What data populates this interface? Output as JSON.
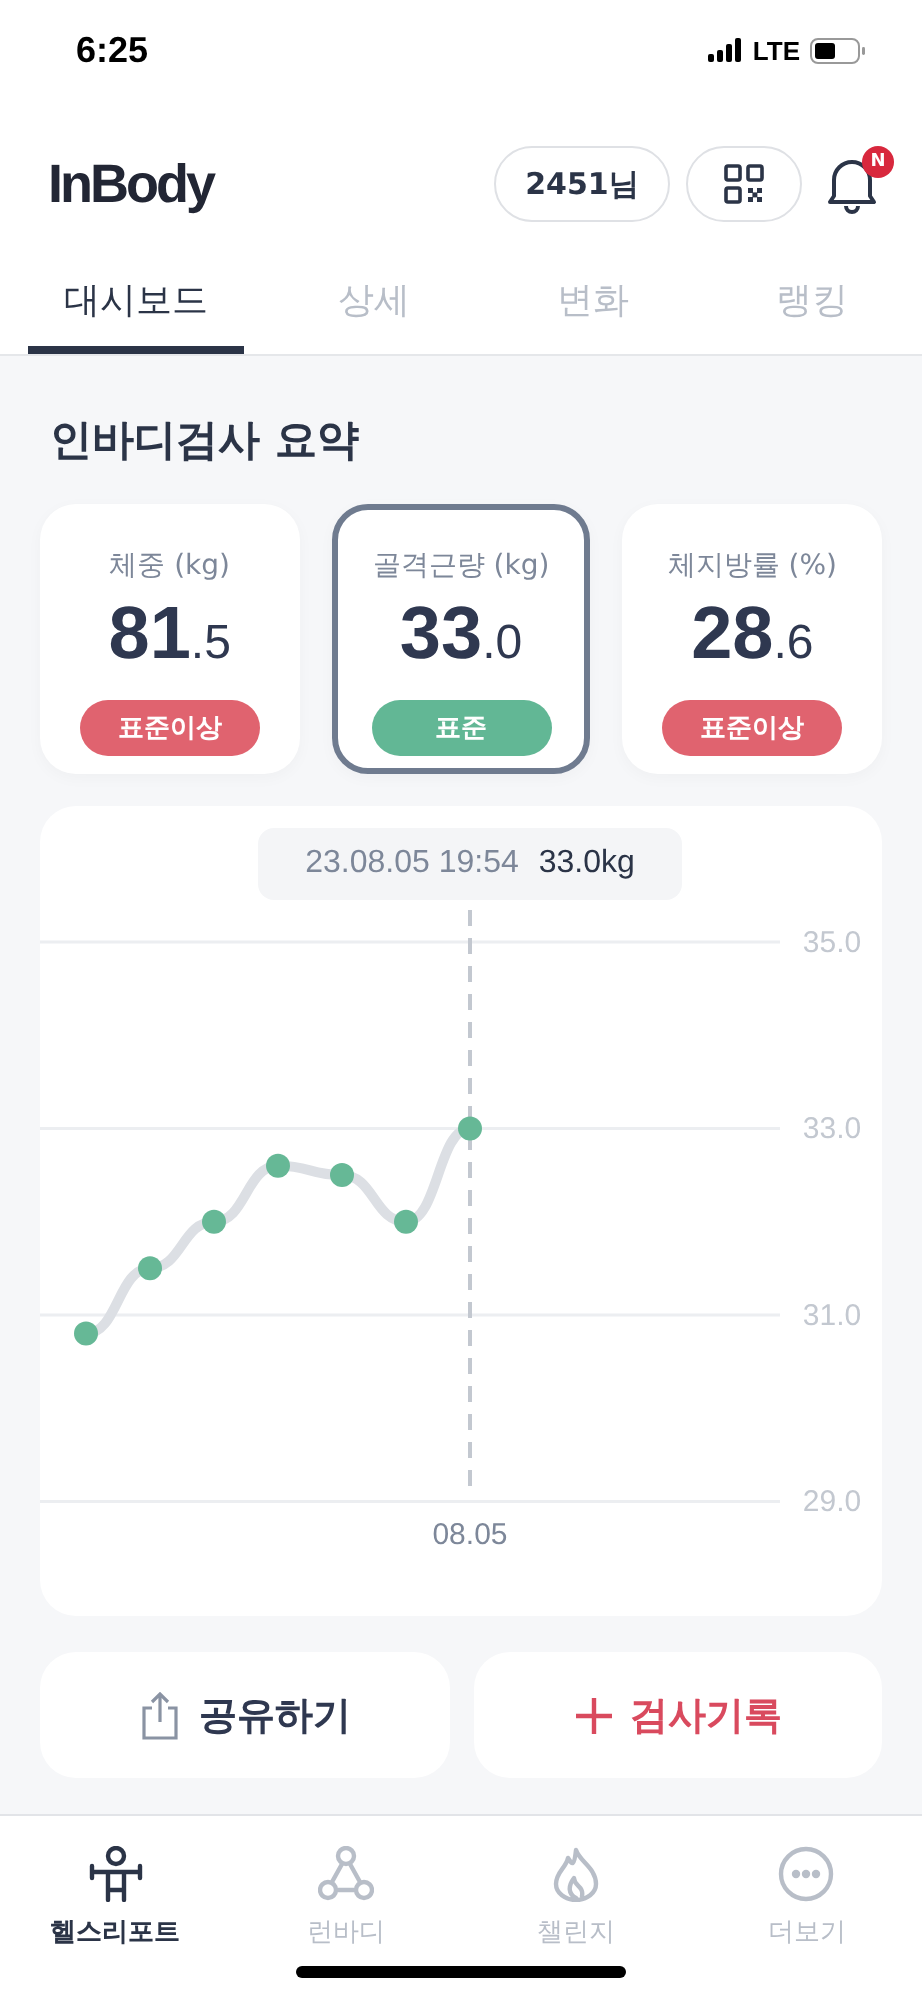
{
  "status_bar": {
    "time": "6:25",
    "network": "LTE"
  },
  "header": {
    "logo": "InBody",
    "user_chip": "2451님",
    "notification_badge": "N"
  },
  "tabs": [
    {
      "label": "대시보드",
      "selected": true
    },
    {
      "label": "상세",
      "selected": false
    },
    {
      "label": "변화",
      "selected": false
    },
    {
      "label": "랭킹",
      "selected": false
    }
  ],
  "summary": {
    "title": "인바디검사 요약",
    "cards": [
      {
        "label": "체중 (kg)",
        "value": "81",
        "decimal": ".5",
        "status": "표준이상",
        "kind": "above",
        "selected": false
      },
      {
        "label": "골격근량 (kg)",
        "value": "33",
        "decimal": ".0",
        "status": "표준",
        "kind": "normal",
        "selected": true
      },
      {
        "label": "체지방률 (%)",
        "value": "28",
        "decimal": ".6",
        "status": "표준이상",
        "kind": "above",
        "selected": false
      }
    ]
  },
  "chart": {
    "tooltip": {
      "date": "23.08.05 19:54",
      "value": "33.0kg"
    },
    "cursor_label": "08.05",
    "chart_data": {
      "type": "line",
      "ylim": [
        29,
        35
      ],
      "yticks": [
        {
          "value": 29,
          "label": "29.0"
        },
        {
          "value": 31,
          "label": "31.0"
        },
        {
          "value": 33,
          "label": "33.0"
        },
        {
          "value": 35,
          "label": "35.0"
        }
      ],
      "series": [
        {
          "marker": true,
          "color": "#66b896",
          "values": [
            30.8,
            31.5,
            32.0,
            32.6,
            32.5,
            32.0,
            33.0
          ]
        }
      ]
    }
  },
  "actions": [
    {
      "label": "공유하기",
      "kind": "share"
    },
    {
      "label": "검사기록",
      "kind": "add"
    }
  ],
  "bottom_nav": [
    {
      "label": "헬스리포트",
      "selected": true
    },
    {
      "label": "런바디",
      "selected": false
    },
    {
      "label": "챌린지",
      "selected": false
    },
    {
      "label": "더보기",
      "selected": false
    }
  ]
}
